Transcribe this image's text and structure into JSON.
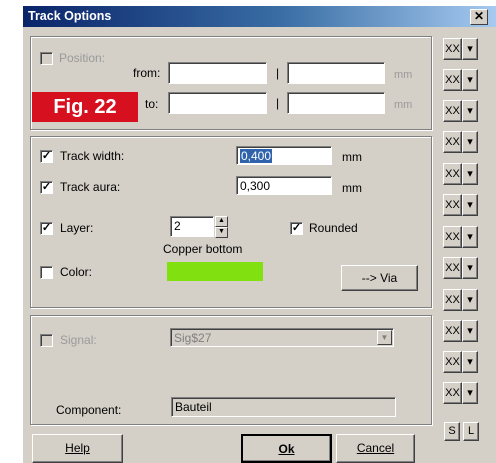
{
  "window": {
    "title": "Track Options",
    "close_glyph": "✕"
  },
  "figure_badge": "Fig. 22",
  "position": {
    "label": "Position:",
    "from_label": "from:",
    "to_label": "to:",
    "separator": "|",
    "unit": "mm",
    "from_x": "",
    "from_y": "",
    "to_x": "",
    "to_y": ""
  },
  "track_width": {
    "label": "Track width:",
    "value": "0,400",
    "unit": "mm",
    "checked": true
  },
  "track_aura": {
    "label": "Track aura:",
    "value": "0,300",
    "unit": "mm",
    "checked": true
  },
  "layer": {
    "label": "Layer:",
    "value": "2",
    "description": "Copper bottom",
    "checked": true
  },
  "rounded": {
    "label": "Rounded",
    "checked": true
  },
  "color": {
    "label": "Color:",
    "swatch": "#80e010",
    "checked": false
  },
  "via_button": "--> Via",
  "signal": {
    "label": "Signal:",
    "value": "Sig$27"
  },
  "component": {
    "label": "Component:",
    "value": "Bauteil"
  },
  "buttons": {
    "help": "Help",
    "ok": "Ok",
    "cancel": "Cancel"
  },
  "side_buttons": {
    "left_glyph": "XX",
    "right_glyph": "▾",
    "s_label": "S",
    "l_label": "L"
  },
  "check_glyph": "✓"
}
